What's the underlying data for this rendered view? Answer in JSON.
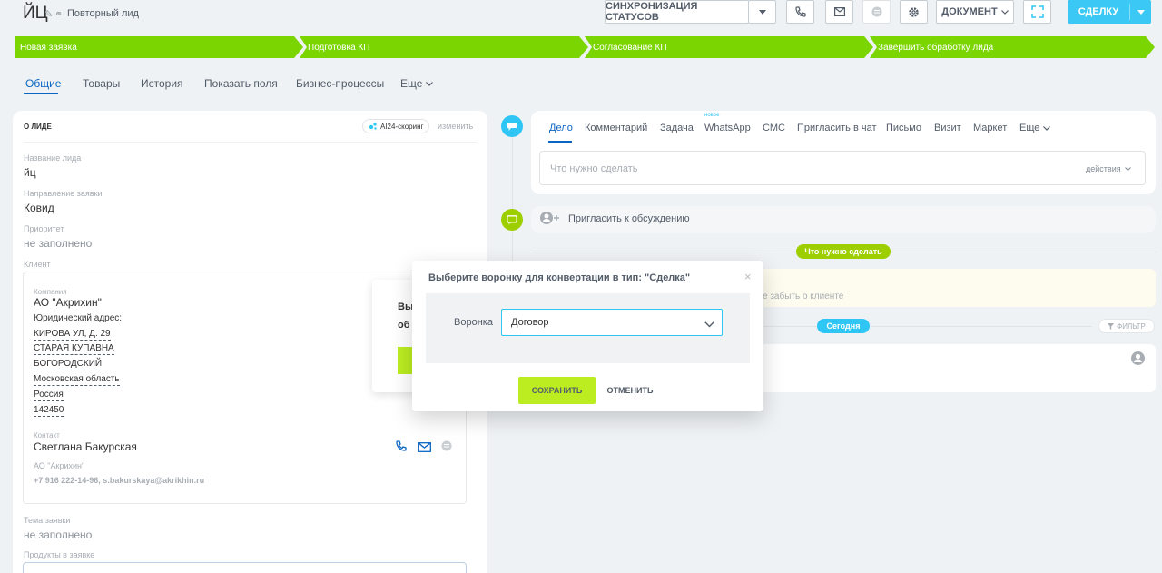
{
  "header": {
    "title": "ЙЦ",
    "subtitle": "Повторный лид",
    "sync_label": "СИНХРОНИЗАЦИЯ СТАТУСОВ",
    "document_label": "ДОКУМЕНТ",
    "deal_label": "СДЕЛКУ"
  },
  "stages": [
    "Новая заявка",
    "Подготовка КП",
    "Согласование КП",
    "Завершить обработку лида"
  ],
  "tabs": [
    "Общие",
    "Товары",
    "История",
    "Показать поля",
    "Бизнес-процессы",
    "Еще"
  ],
  "lead": {
    "section_title": "О ЛИДЕ",
    "ai_badge": "AI24-скоринг",
    "edit_label": "изменить",
    "name_label": "Название лида",
    "name_value": "йц",
    "direction_label": "Направление заявки",
    "direction_value": "Ковид",
    "priority_label": "Приоритет",
    "priority_value": "не заполнено",
    "client_label": "Клиент",
    "topic_label": "Тема заявки",
    "topic_value": "не заполнено",
    "products_label": "Продукты в заявке"
  },
  "client": {
    "company_label": "Компания",
    "company_name": "АО \"Акрихин\"",
    "address_label": "Юридический адрес:",
    "address_lines": [
      "КИРОВА УЛ, Д. 29",
      "СТАРАЯ КУПАВНА",
      "БОГОРОДСКИЙ",
      "Московская область",
      "Россия",
      "142450"
    ],
    "contact_label": "Контакт",
    "contact_name": "Светлана Бакурская",
    "contact_company": "АО \"Акрихин\"",
    "contact_info": "+7 916 222-14-96, s.bakurskaya@akrikhin.ru"
  },
  "behind_popup": {
    "line1": "Вы",
    "line2": "об"
  },
  "activity": {
    "tabs": [
      "Дело",
      "Комментарий",
      "Задача",
      "WhatsApp",
      "СМС",
      "Пригласить в чат",
      "Письмо",
      "Визит",
      "Маркет",
      "Еще"
    ],
    "new_badge": "новое",
    "todo_placeholder": "Что нужно сделать",
    "actions_label": "действия",
    "invite_label": "Пригласить к обсуждению",
    "todo_pill": "Что нужно сделать",
    "reminder_text": "е забыть о клиенте",
    "today_pill": "Сегодня",
    "filter_label": "ФИЛЬТР"
  },
  "dialog": {
    "title": "Выберите воронку для конвертации в тип: \"Сделка\"",
    "field_label": "Воронка",
    "field_value": "Договор",
    "save_label": "СОХРАНИТЬ",
    "cancel_label": "ОТМЕНИТЬ"
  },
  "colors": {
    "stage_green": "#7bd500",
    "primary_blue": "#3bc8f5",
    "link_blue": "#0b66c3",
    "save_green": "#bbed21"
  }
}
